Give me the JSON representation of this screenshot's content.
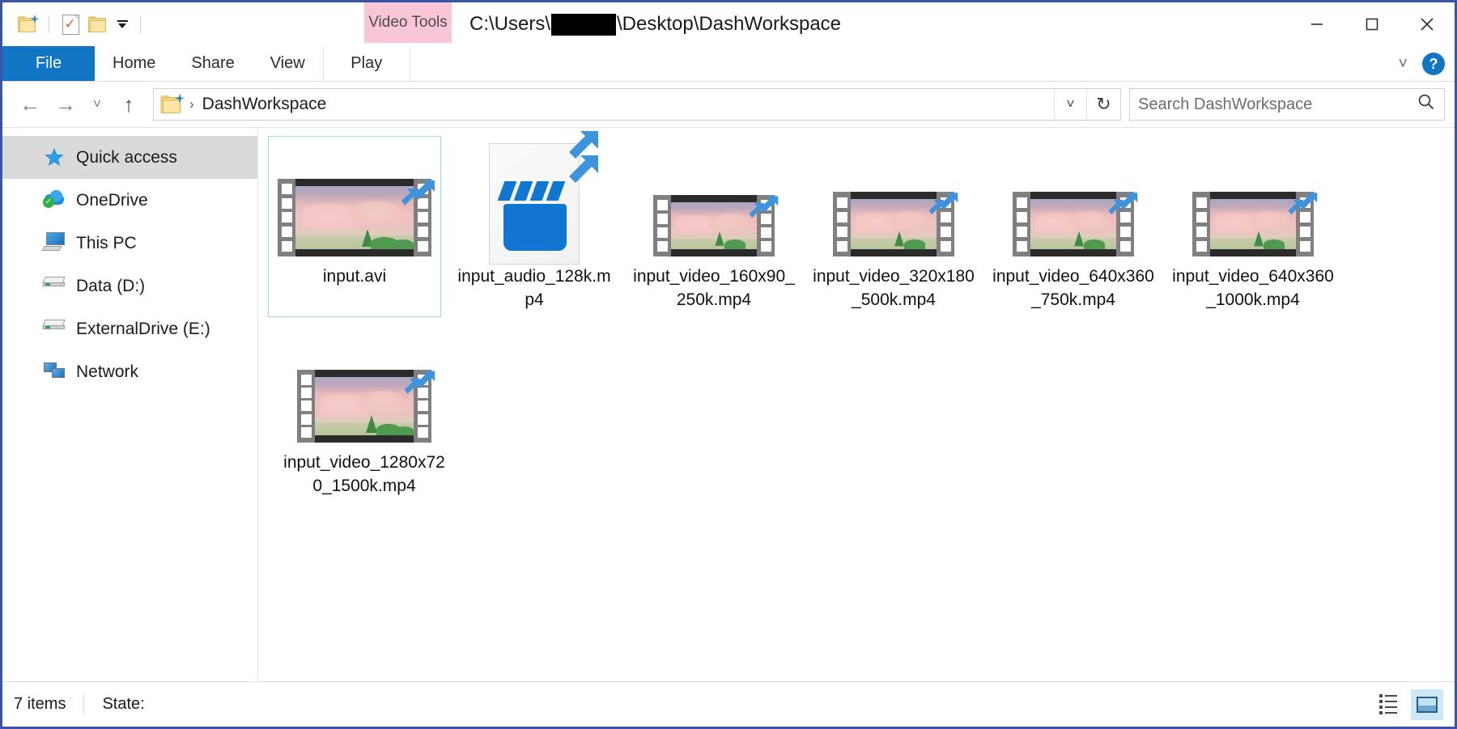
{
  "window": {
    "title_prefix": "C:\\Users",
    "title_suffix": "\\Desktop\\DashWorkspace",
    "username_redacted": true
  },
  "quick_access_toolbar": {
    "items": [
      {
        "name": "properties-folder-icon",
        "label": ""
      },
      {
        "name": "new-folder-icon",
        "label": ""
      },
      {
        "name": "customize-caret-icon",
        "label": ""
      }
    ]
  },
  "window_controls": {
    "minimize": "─",
    "maximize": "☐",
    "close": "✕"
  },
  "ribbon": {
    "contextual_group": "Video Tools",
    "tabs": [
      {
        "label": "File",
        "active": true
      },
      {
        "label": "Home",
        "active": false
      },
      {
        "label": "Share",
        "active": false
      },
      {
        "label": "View",
        "active": false
      },
      {
        "label": "Play",
        "active": false
      }
    ],
    "collapse_icon": "˅",
    "help_icon": "?"
  },
  "addressbar": {
    "back_icon": "←",
    "forward_icon": "→",
    "recent_icon": "˅",
    "up_icon": "↑",
    "breadcrumb_separator": "›",
    "breadcrumb": "DashWorkspace",
    "dropdown_icon": "˅",
    "refresh_icon": "↻",
    "search_placeholder": "Search DashWorkspace",
    "search_value": "",
    "search_icon": "⌕"
  },
  "sidebar": {
    "items": [
      {
        "label": "Quick access",
        "icon": "star-icon",
        "selected": true
      },
      {
        "label": "OneDrive",
        "icon": "cloud-icon",
        "selected": false
      },
      {
        "label": "This PC",
        "icon": "computer-icon",
        "selected": false
      },
      {
        "label": "Data (D:)",
        "icon": "drive-icon",
        "selected": false
      },
      {
        "label": "ExternalDrive (E:)",
        "icon": "drive-icon",
        "selected": false
      },
      {
        "label": "Network",
        "icon": "network-icon",
        "selected": false
      }
    ]
  },
  "files": [
    {
      "name": "input.avi",
      "icon": "film-strip-icon",
      "selected": true
    },
    {
      "name": "input_audio_128k.mp4",
      "icon": "clapperboard-document-icon",
      "selected": false
    },
    {
      "name": "input_video_160x90_250k.mp4",
      "icon": "film-strip-icon",
      "selected": false
    },
    {
      "name": "input_video_320x180_500k.mp4",
      "icon": "film-strip-icon",
      "selected": false
    },
    {
      "name": "input_video_640x360_750k.mp4",
      "icon": "film-strip-icon",
      "selected": false
    },
    {
      "name": "input_video_640x360_1000k.mp4",
      "icon": "film-strip-icon",
      "selected": false
    },
    {
      "name": "input_video_1280x720_1500k.mp4",
      "icon": "film-strip-icon",
      "selected": false
    }
  ],
  "statusbar": {
    "item_count": "7 items",
    "state_label": "State:",
    "details_view_title": "Details view",
    "large_icons_view_title": "Large icons view"
  },
  "colors": {
    "accent": "#1175c4",
    "window_border": "#3b55a6",
    "contextual_tab": "#f9c6d9",
    "selection": "#dadada",
    "tile_selected_border": "#9cd3f0"
  }
}
